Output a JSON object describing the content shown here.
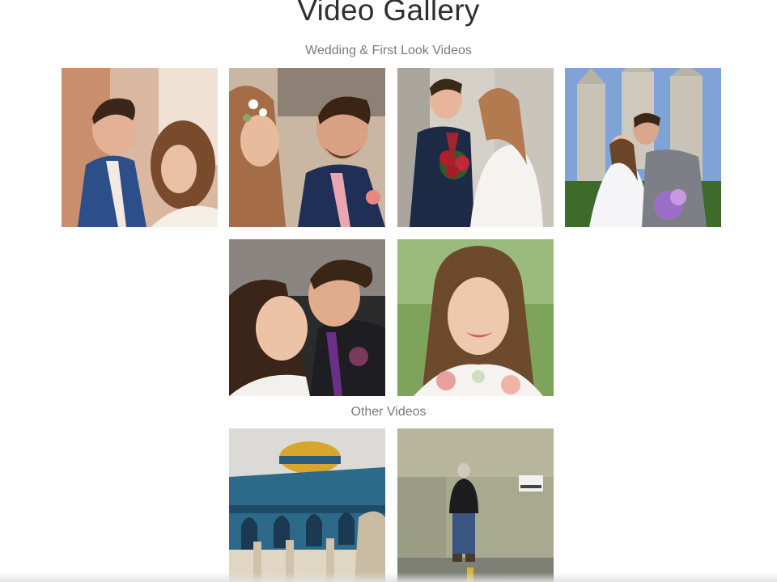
{
  "gallery": {
    "title": "Video Gallery"
  },
  "sections": [
    {
      "heading": "Wedding & First Look Videos",
      "videos": [
        {
          "subject": "couple forehead kiss",
          "accent": "#2c4f8a"
        },
        {
          "subject": "bride with flower crown and groom",
          "accent": "#1f2f55"
        },
        {
          "subject": "couple laughing with bouquet",
          "accent": "#b01e2a"
        },
        {
          "subject": "temple kiss",
          "accent": "#6f8fc4"
        },
        {
          "subject": "couple cheek to cheek",
          "accent": "#6b2f8a"
        },
        {
          "subject": "bride portrait",
          "accent": "#6b9a4a"
        }
      ]
    },
    {
      "heading": "Other Videos",
      "videos": [
        {
          "subject": "dome of the rock",
          "accent": "#d9a52c"
        },
        {
          "subject": "person at concrete wall",
          "accent": "#8c8f74"
        }
      ]
    }
  ]
}
